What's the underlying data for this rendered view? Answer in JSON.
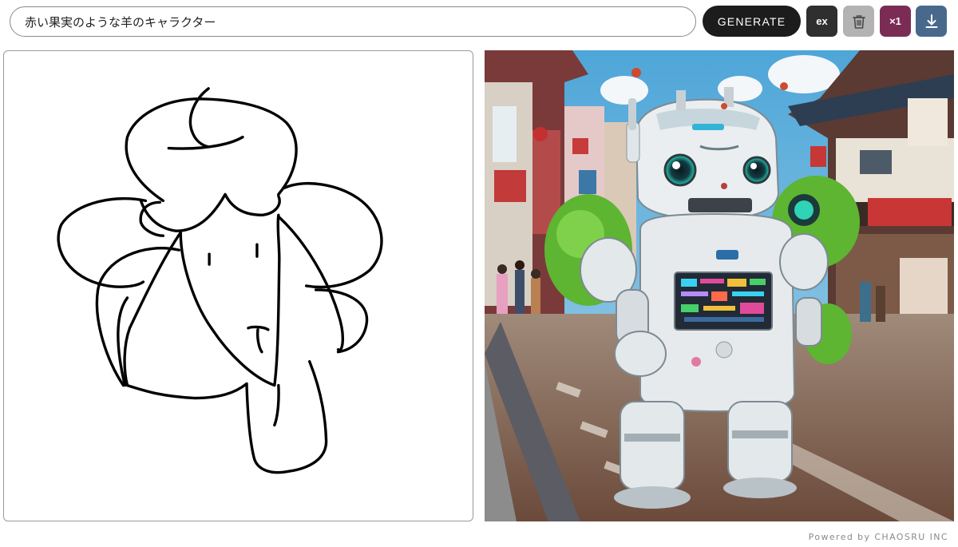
{
  "prompt": {
    "value": "赤い果実のような羊のキャラクター"
  },
  "toolbar": {
    "generate_label": "GENERATE",
    "ex_label": "ex",
    "count_label": "×1",
    "trash_icon": "trash-icon",
    "download_icon": "download-icon"
  },
  "footer": {
    "text": "Powered by CHAOSRU INC"
  },
  "colors": {
    "generate": "#1c1c1c",
    "ex": "#2f2f2f",
    "trash": "#b3b3b3",
    "count": "#7b2c55",
    "download": "#48698c"
  }
}
